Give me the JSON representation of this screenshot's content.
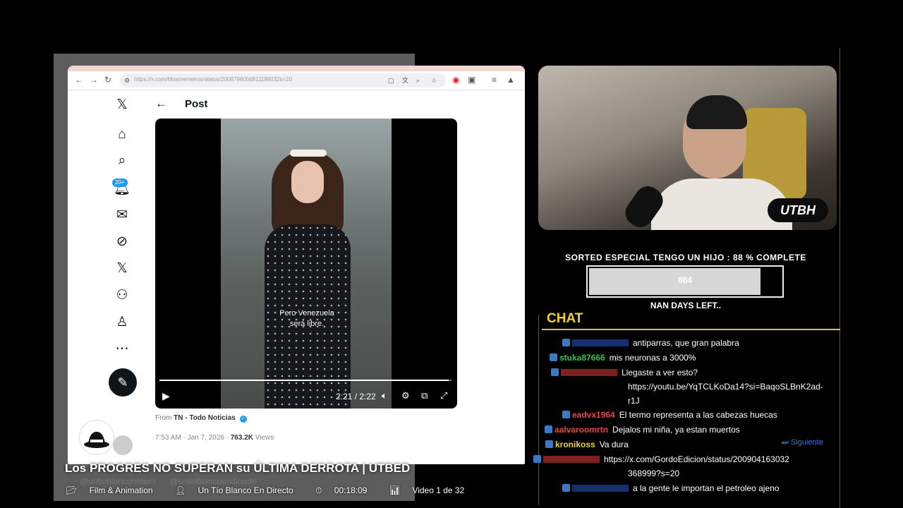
{
  "browser": {
    "url": "https://x.com/Mosmemeirss/status/2008796056811198032s=20",
    "nav_icons": [
      "back-arrow-icon",
      "forward-arrow-icon",
      "reload-icon"
    ],
    "toolbar_icons": [
      "extension-icon",
      "translate-icon",
      "zoom-icon",
      "bookmark-star-icon",
      "opera-icon",
      "puzzle-icon",
      "menu-icon",
      "profile-icon"
    ]
  },
  "x_nav": {
    "items": [
      "x-logo-icon",
      "home-icon",
      "search-icon",
      "notifications-icon",
      "messages-icon",
      "grok-icon",
      "premium-x-icon",
      "communities-icon",
      "profile-icon",
      "more-icon"
    ],
    "notifications_badge": "20+"
  },
  "post": {
    "title": "Post",
    "video": {
      "subtitle_line1": "Pero Venezuela",
      "subtitle_line2": "será libre.",
      "time": "2:21 / 2:22",
      "progress": 0.99
    },
    "source_prefix": "From",
    "source_name": "TN - Todo Noticias",
    "timestamp": "7:53 AM · Jan 7, 2026 ·",
    "views_count": "763.2K",
    "views_label": "Views"
  },
  "webcam": {
    "logo": "UTBH"
  },
  "goal": {
    "title": "SORTED ESPECIAL TENGO UN HIJO : 88 % COMPLETE",
    "value": "884",
    "fraction": 0.88,
    "footer": "NAN DAYS LEFT.."
  },
  "chat": {
    "title": "CHAT",
    "messages": [
      {
        "user": "",
        "user_color": "#2a55c9",
        "text": "antiparras, que gran palabra"
      },
      {
        "user": "stuka87666",
        "user_color": "#35c24a",
        "text": "mis neuronas a 3000%"
      },
      {
        "user": "",
        "user_color": "#e23b3b",
        "text": "Llegaste a ver esto?"
      },
      {
        "user": "",
        "user_color": "#ffffff",
        "text": "https://youtu.be/YqTCLKoDa14?si=BaqoSLBnK2ad-"
      },
      {
        "user": "",
        "user_color": "#ffffff",
        "text": "r1J"
      },
      {
        "user": "eadvx1964",
        "user_color": "#e24a4a",
        "text": "El termo representa a las cabezas huecas"
      },
      {
        "user": "aalvaroomrtn",
        "user_color": "#e24a4a",
        "text": "Dejalos mi niña, ya estan muertos"
      },
      {
        "user": "kronikoss",
        "user_color": "#e8d442",
        "text": "Va dura"
      },
      {
        "user": "",
        "user_color": "#e23b3b",
        "text": "https://x.com/GordoEdicion/status/200904163032"
      },
      {
        "user": "",
        "user_color": "#ffffff",
        "text": "368999?s=20"
      },
      {
        "user": "",
        "user_color": "#2a55c9",
        "text": "a la gente le importan el petroleo ajeno"
      }
    ],
    "next_label": "Siguiente"
  },
  "caption": {
    "title": "Los PROGRES NO SUPERAN su ÚLTIMA DERROTA | UTBED",
    "category": "Film & Animation",
    "channel": "Un Tío Blanco En Directo",
    "duration": "00:18:09",
    "playlist": "Video 1 de 32",
    "watermark_left": "@untioblancohetero",
    "watermark_right": "@untioblancoendirecto"
  }
}
